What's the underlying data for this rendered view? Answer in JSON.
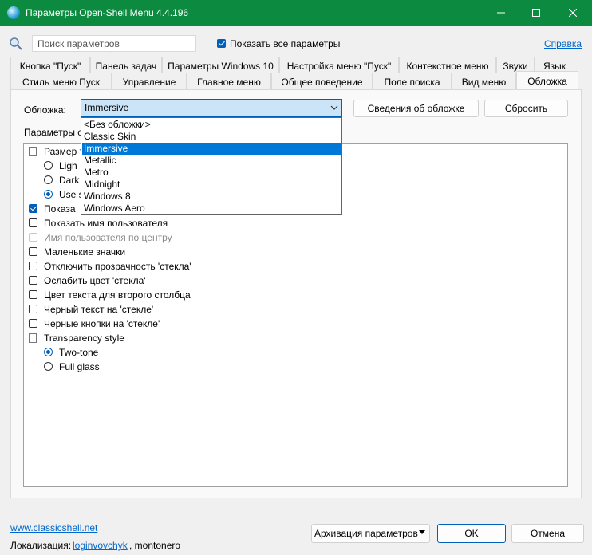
{
  "window": {
    "title": "Параметры Open-Shell Menu 4.4.196",
    "accent_color": "#0c8a3f"
  },
  "toolbar": {
    "search_placeholder": "Поиск параметров",
    "show_all_label": "Показать все параметры",
    "show_all_checked": true,
    "help_link": "Справка"
  },
  "tabs": {
    "row1": [
      "Кнопка \"Пуск\"",
      "Панель задач",
      "Параметры Windows 10",
      "Настройка меню \"Пуск\"",
      "Контекстное меню",
      "Звуки",
      "Язык"
    ],
    "row2": [
      "Стиль меню Пуск",
      "Управление",
      "Главное меню",
      "Общее поведение",
      "Поле поиска",
      "Вид меню",
      "Обложка"
    ],
    "active": "Обложка"
  },
  "skin": {
    "label": "Обложка:",
    "selected": "Immersive",
    "info_button": "Сведения об обложке",
    "reset_button": "Сбросить",
    "options": [
      "<Без обложки>",
      "Classic Skin",
      "Immersive",
      "Metallic",
      "Metro",
      "Midnight",
      "Windows 8",
      "Windows Aero"
    ]
  },
  "params": {
    "label": "Параметры о",
    "items": {
      "size_header": "Размер т",
      "light": "Ligh",
      "dark": "Dark",
      "use_system": "Use s",
      "show_partial": "Показа",
      "show_username": "Показать имя пользователя",
      "center_username": "Имя пользователя по центру",
      "small_icons": "Маленькие значки",
      "disable_glass": "Отключить прозрачность 'стекла'",
      "weaken_glass": "Ослабить цвет 'стекла'",
      "second_column_color": "Цвет текста для второго столбца",
      "black_text": "Черный текст на 'стекле'",
      "black_buttons": "Черные кнопки на 'стекле'",
      "transparency_style": "Transparency style",
      "two_tone": "Two-tone",
      "full_glass": "Full glass"
    }
  },
  "footer": {
    "site_link": "www.classicshell.net",
    "localization_label": "Локализация:",
    "author1": "loginvovchyk",
    "author_rest": ", montonero",
    "archive_button": "Архивация параметров",
    "ok_button": "OK",
    "cancel_button": "Отмена"
  }
}
